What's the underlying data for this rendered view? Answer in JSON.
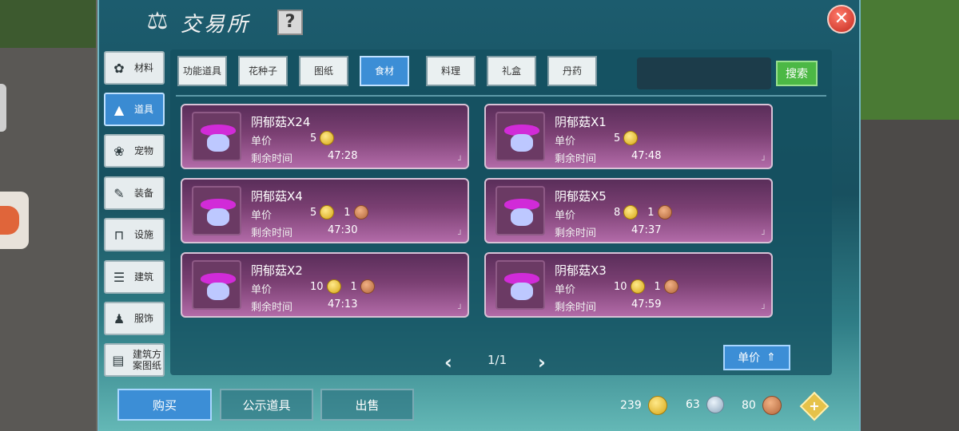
{
  "window": {
    "title": "交易所",
    "help": "?",
    "close": "✕"
  },
  "sidebar": {
    "items": [
      {
        "label": "材料",
        "icon": "materials-icon",
        "glyph": "✿",
        "active": false
      },
      {
        "label": "道具",
        "icon": "items-icon",
        "glyph": "▲",
        "active": true
      },
      {
        "label": "宠物",
        "icon": "paw-icon",
        "glyph": "❀",
        "active": false
      },
      {
        "label": "装备",
        "icon": "equipment-icon",
        "glyph": "✎",
        "active": false
      },
      {
        "label": "设施",
        "icon": "facility-icon",
        "glyph": "⊓",
        "active": false
      },
      {
        "label": "建筑",
        "icon": "building-icon",
        "glyph": "☰",
        "active": false
      },
      {
        "label": "服饰",
        "icon": "clothing-icon",
        "glyph": "♟",
        "active": false
      },
      {
        "label": "建筑方案图纸",
        "icon": "blueprint-icon",
        "glyph": "▤",
        "active": false
      }
    ]
  },
  "tabs": [
    {
      "label": "功能道具",
      "active": false
    },
    {
      "label": "花种子",
      "active": false
    },
    {
      "label": "图纸",
      "active": false
    },
    {
      "label": "食材",
      "active": true
    },
    {
      "label": "料理",
      "active": false
    },
    {
      "label": "礼盒",
      "active": false
    },
    {
      "label": "丹药",
      "active": false
    }
  ],
  "search": {
    "placeholder": "",
    "button": "搜索"
  },
  "labels": {
    "price": "单价",
    "time_left": "剩余时间"
  },
  "listings": [
    {
      "name": "阴郁菇X24",
      "gold": "5",
      "copper": "",
      "time": "47:28"
    },
    {
      "name": "阴郁菇X1",
      "gold": "5",
      "copper": "",
      "time": "47:48"
    },
    {
      "name": "阴郁菇X4",
      "gold": "5",
      "copper": "1",
      "time": "47:30"
    },
    {
      "name": "阴郁菇X5",
      "gold": "8",
      "copper": "1",
      "time": "47:37"
    },
    {
      "name": "阴郁菇X2",
      "gold": "10",
      "copper": "1",
      "time": "47:13"
    },
    {
      "name": "阴郁菇X3",
      "gold": "10",
      "copper": "1",
      "time": "47:59"
    }
  ],
  "pager": {
    "text": "1/1",
    "prev": "‹",
    "next": "›"
  },
  "sort": {
    "label": "单价",
    "arrow": "⇑"
  },
  "bottom": {
    "buy": "购买",
    "public": "公示道具",
    "sell": "出售"
  },
  "currency": {
    "gold": "239",
    "silver": "63",
    "copper": "80",
    "add": "+"
  },
  "colors": {
    "accent_blue": "#3c8ed6",
    "card_purple": "#7a3f72",
    "search_green": "#4cb845",
    "close_red": "#c42a1f"
  }
}
